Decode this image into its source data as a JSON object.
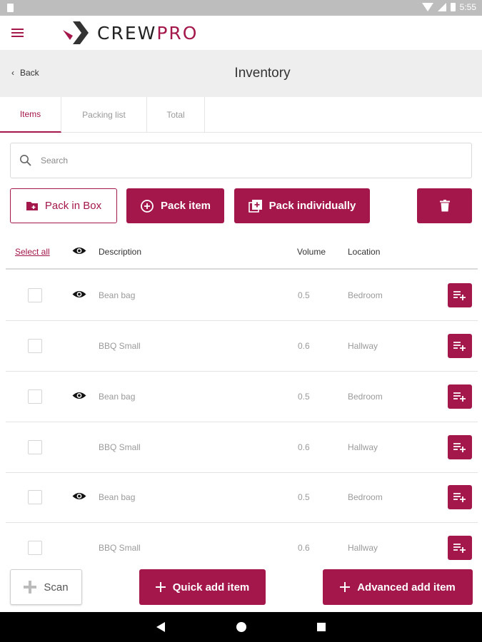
{
  "status_bar": {
    "time": "5:55"
  },
  "header": {
    "logo_part1": "CREW",
    "logo_part2": "PRO",
    "accent": "#a3174b"
  },
  "title_bar": {
    "back_label": "Back",
    "title": "Inventory"
  },
  "tabs": [
    {
      "label": "Items",
      "active": true
    },
    {
      "label": "Packing list",
      "active": false
    },
    {
      "label": "Total",
      "active": false
    }
  ],
  "search": {
    "placeholder": "Search"
  },
  "actions": {
    "pack_in_box": "Pack in Box",
    "pack_item": "Pack item",
    "pack_individually": "Pack individually"
  },
  "table": {
    "select_all": "Select all",
    "columns": {
      "description": "Description",
      "volume": "Volume",
      "location": "Location"
    },
    "rows": [
      {
        "description": "Bean bag",
        "volume": "0.5",
        "location": "Bedroom",
        "visible_icon": true,
        "checked": false
      },
      {
        "description": "BBQ Small",
        "volume": "0.6",
        "location": "Hallway",
        "visible_icon": false,
        "checked": false
      },
      {
        "description": "Bean bag",
        "volume": "0.5",
        "location": "Bedroom",
        "visible_icon": true,
        "checked": false
      },
      {
        "description": "BBQ Small",
        "volume": "0.6",
        "location": "Hallway",
        "visible_icon": false,
        "checked": false
      },
      {
        "description": "Bean bag",
        "volume": "0.5",
        "location": "Bedroom",
        "visible_icon": true,
        "checked": false
      },
      {
        "description": "BBQ Small",
        "volume": "0.6",
        "location": "Hallway",
        "visible_icon": false,
        "checked": false
      }
    ]
  },
  "footer": {
    "scan": "Scan",
    "quick_add": "Quick add item",
    "advanced_add": "Advanced add item"
  },
  "icons": {
    "menu": "hamburger-icon",
    "back": "chevron-left-icon",
    "search": "search-icon",
    "pack_in_box": "folder-plus-icon",
    "pack_item": "plus-circle-icon",
    "pack_individually": "library-add-icon",
    "delete": "trash-icon",
    "visibility": "eye-icon",
    "add_to_list": "playlist-add-icon",
    "scan": "crosshair-icon",
    "add": "plus-icon"
  }
}
